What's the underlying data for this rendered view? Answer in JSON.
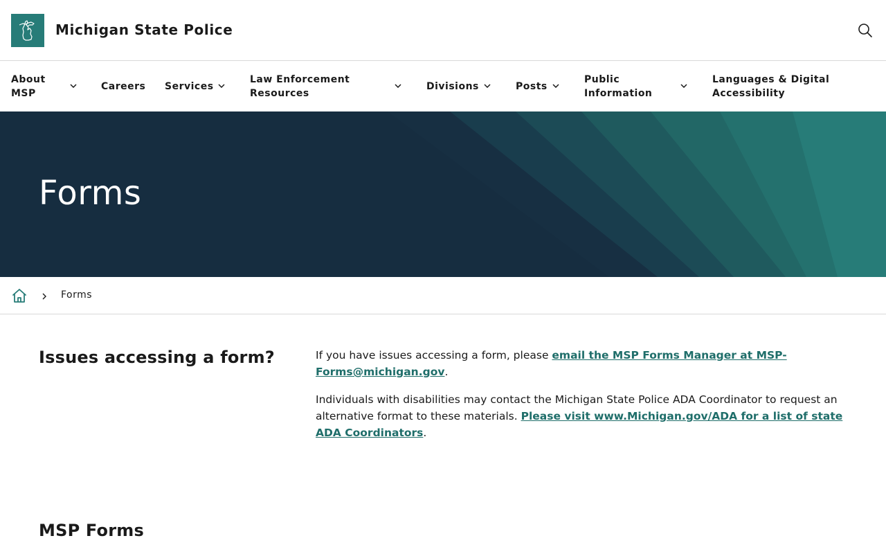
{
  "header": {
    "site_name": "Michigan State Police",
    "logo_icon": "michigan-map-icon",
    "search_icon": "search-icon"
  },
  "nav": {
    "items": [
      {
        "label": "About\nMSP",
        "has_dropdown": true
      },
      {
        "label": "Careers",
        "has_dropdown": false
      },
      {
        "label": "Services",
        "has_dropdown": true
      },
      {
        "label": "Law Enforcement\nResources",
        "has_dropdown": true
      },
      {
        "label": "Divisions",
        "has_dropdown": true
      },
      {
        "label": "Posts",
        "has_dropdown": true
      },
      {
        "label": "Public\nInformation",
        "has_dropdown": true
      },
      {
        "label": "Languages & Digital\nAccessibility",
        "has_dropdown": false
      }
    ]
  },
  "hero": {
    "title": "Forms"
  },
  "breadcrumb": {
    "home_icon": "home-icon",
    "current": "Forms"
  },
  "content": {
    "issues_heading": "Issues accessing a form?",
    "p1_text": "If you have issues accessing a form, please ",
    "p1_link": "email the MSP Forms Manager at MSP-Forms@michigan.gov",
    "p1_end": ".",
    "p2_text": "Individuals with disabilities may contact the Michigan State Police ADA Coordinator to request an alternative format to these materials. ",
    "p2_link": "Please visit www.Michigan.gov/ADA for a list of state ADA Coordinators",
    "p2_end": ".",
    "forms_heading": "MSP Forms"
  },
  "colors": {
    "brand_teal": "#277c78",
    "hero_navy": "#162d40",
    "link": "#1f6e6a"
  }
}
